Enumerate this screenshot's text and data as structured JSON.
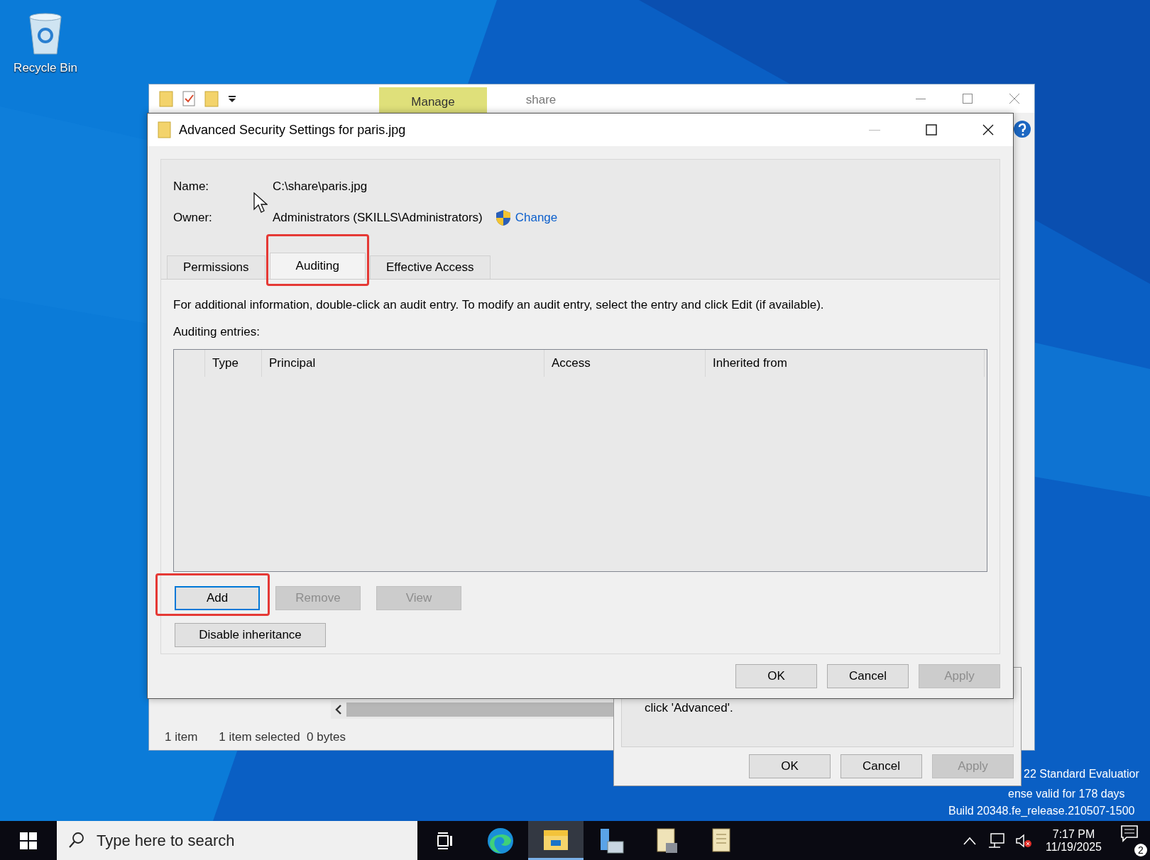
{
  "desktop": {
    "icons": [
      {
        "label": "Recycle Bin"
      }
    ],
    "watermark": [
      "22 Standard Evaluatior",
      "ense valid for 178 days",
      "Build 20348.fe_release.210507-1500"
    ]
  },
  "explorer": {
    "ribbon_tabs": [
      {
        "label": "Manage",
        "selected": true
      },
      {
        "label": "share",
        "selected": false
      }
    ],
    "status_bar": [
      "1 item",
      "1 item selected  0 bytes"
    ]
  },
  "properties_dialog": {
    "text": "click 'Advanced'.",
    "buttons": [
      {
        "label": "OK",
        "disabled": false
      },
      {
        "label": "Cancel",
        "disabled": false
      },
      {
        "label": "Apply",
        "disabled": true
      }
    ]
  },
  "dialog": {
    "title": "Advanced Security Settings for paris.jpg",
    "name_label": "Name:",
    "name_value": "C:\\share\\paris.jpg",
    "owner_label": "Owner:",
    "owner_value": "Administrators (SKILLS\\Administrators)",
    "change_link": "Change",
    "tabs": [
      {
        "label": "Permissions",
        "selected": false,
        "highlighted": false
      },
      {
        "label": "Auditing",
        "selected": true,
        "highlighted": true
      },
      {
        "label": "Effective Access",
        "selected": false,
        "highlighted": false
      }
    ],
    "info": "For additional information, double-click an audit entry. To modify an audit entry, select the entry and click Edit (if available).",
    "entries_label": "Auditing entries:",
    "table": {
      "columns": [
        "Type",
        "Principal",
        "Access",
        "Inherited from"
      ]
    },
    "entry_buttons": [
      {
        "label": "Add",
        "disabled": false,
        "highlighted": true
      },
      {
        "label": "Remove",
        "disabled": true,
        "highlighted": false
      },
      {
        "label": "View",
        "disabled": true,
        "highlighted": false
      }
    ],
    "inheritance_button": "Disable inheritance",
    "buttons": [
      {
        "label": "OK",
        "disabled": false
      },
      {
        "label": "Cancel",
        "disabled": false
      },
      {
        "label": "Apply",
        "disabled": true
      }
    ]
  },
  "taskbar": {
    "search": {
      "placeholder": "Type here to search"
    },
    "apps": [
      {
        "kind": "taskview",
        "active": false
      },
      {
        "kind": "edge",
        "active": false
      },
      {
        "kind": "explorer",
        "active": true
      },
      {
        "kind": "server",
        "active": false
      },
      {
        "kind": "script",
        "active": false
      },
      {
        "kind": "notepad",
        "active": false
      }
    ],
    "time": "7:17 PM",
    "date": "11/19/2025",
    "notifications": "2"
  }
}
